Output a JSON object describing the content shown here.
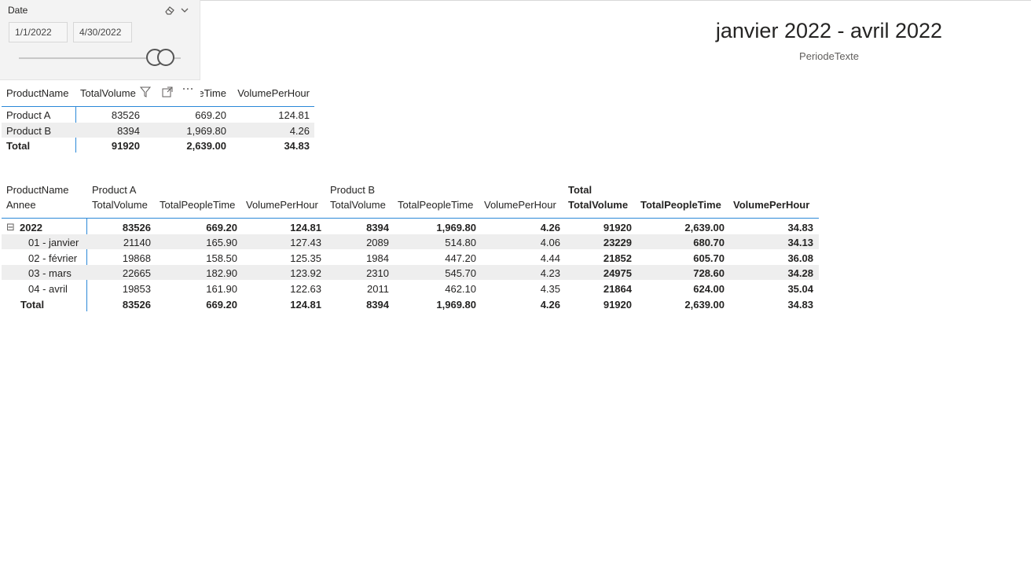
{
  "slicer": {
    "title": "Date",
    "start_date": "1/1/2022",
    "end_date": "4/30/2022",
    "icons": [
      "eraser-icon",
      "chevron-down-icon"
    ]
  },
  "card": {
    "title": "janvier 2022 - avril 2022",
    "subtitle": "PeriodeTexte"
  },
  "table1": {
    "headers": [
      "ProductName",
      "TotalVolume",
      "TotalPeopleTime",
      "VolumePerHour"
    ],
    "header_visible": [
      "ProductName",
      "TotalVolume",
      "eTime",
      "VolumePerHour"
    ],
    "rows": [
      [
        "Product A",
        "83526",
        "669.20",
        "124.81"
      ],
      [
        "Product B",
        "8394",
        "1,969.80",
        "4.26"
      ]
    ],
    "total": [
      "Total",
      "91920",
      "2,639.00",
      "34.83"
    ],
    "header_icons": [
      "filter-icon",
      "focus-mode-icon",
      "more-options-icon"
    ]
  },
  "matrix": {
    "col_field": "ProductName",
    "row_field": "Annee",
    "groups": [
      {
        "name": "Product A",
        "bold": false
      },
      {
        "name": "Product B",
        "bold": false
      },
      {
        "name": "Total",
        "bold": true
      }
    ],
    "measures": [
      "TotalVolume",
      "TotalPeopleTime",
      "VolumePerHour"
    ],
    "rows": [
      {
        "label": "2022",
        "level": 0,
        "expand": "⊟",
        "bold": true,
        "values": [
          "83526",
          "669.20",
          "124.81",
          "8394",
          "1,969.80",
          "4.26",
          "91920",
          "2,639.00",
          "34.83"
        ]
      },
      {
        "label": "01 - janvier",
        "level": 1,
        "bold": false,
        "values": [
          "21140",
          "165.90",
          "127.43",
          "2089",
          "514.80",
          "4.06",
          "23229",
          "680.70",
          "34.13"
        ]
      },
      {
        "label": "02 - février",
        "level": 1,
        "bold": false,
        "values": [
          "19868",
          "158.50",
          "125.35",
          "1984",
          "447.20",
          "4.44",
          "21852",
          "605.70",
          "36.08"
        ]
      },
      {
        "label": "03 - mars",
        "level": 1,
        "bold": false,
        "values": [
          "22665",
          "182.90",
          "123.92",
          "2310",
          "545.70",
          "4.23",
          "24975",
          "728.60",
          "34.28"
        ]
      },
      {
        "label": "04 - avril",
        "level": 1,
        "bold": false,
        "values": [
          "19853",
          "161.90",
          "122.63",
          "2011",
          "462.10",
          "4.35",
          "21864",
          "624.00",
          "35.04"
        ]
      },
      {
        "label": "Total",
        "level": 0,
        "bold": true,
        "is_total": true,
        "values": [
          "83526",
          "669.20",
          "124.81",
          "8394",
          "1,969.80",
          "4.26",
          "91920",
          "2,639.00",
          "34.83"
        ]
      }
    ]
  },
  "colors": {
    "accent_line": "#2b88d8",
    "band": "#eeeeee",
    "text": "#252423",
    "slicer_bg": "#f3f3f3"
  }
}
